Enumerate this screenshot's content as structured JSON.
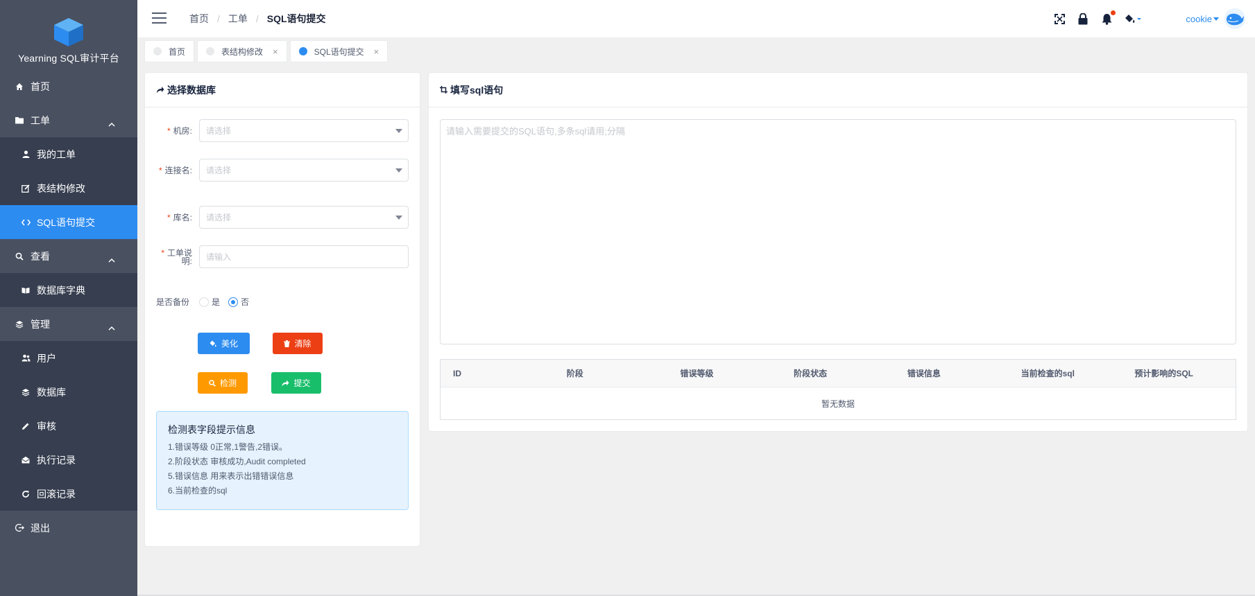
{
  "app": {
    "title": "Yearning SQL审计平台"
  },
  "sidebar": {
    "items": [
      {
        "label": "首页"
      },
      {
        "label": "工单"
      },
      {
        "label": "我的工单"
      },
      {
        "label": "表结构修改"
      },
      {
        "label": "SQL语句提交"
      },
      {
        "label": "查看"
      },
      {
        "label": "数据库字典"
      },
      {
        "label": "管理"
      },
      {
        "label": "用户"
      },
      {
        "label": "数据库"
      },
      {
        "label": "审核"
      },
      {
        "label": "执行记录"
      },
      {
        "label": "回滚记录"
      },
      {
        "label": "退出"
      }
    ]
  },
  "header": {
    "breadcrumb": [
      "首页",
      "工单",
      "SQL语句提交"
    ],
    "separator": "/",
    "user": "cookie"
  },
  "tags": [
    {
      "label": "首页"
    },
    {
      "label": "表结构修改"
    },
    {
      "label": "SQL语句提交"
    }
  ],
  "left_card": {
    "title": "选择数据库",
    "fields": {
      "room": {
        "label": "机房:",
        "placeholder": "请选择"
      },
      "conn": {
        "label": "连接名:",
        "placeholder": "请选择"
      },
      "db": {
        "label": "库名:",
        "placeholder": "请选择"
      },
      "desc": {
        "label": "工单说明:",
        "placeholder": "请输入"
      }
    },
    "backup": {
      "label": "是否备份",
      "yes": "是",
      "no": "否",
      "selected": "否"
    },
    "buttons": {
      "beautify": "美化",
      "clear": "清除",
      "check": "检测",
      "submit": "提交"
    },
    "tips": {
      "title": "检测表字段提示信息",
      "lines": [
        "1.错误等级 0正常,1警告,2错误。",
        "2.阶段状态 审核成功,Audit completed",
        "5.错误信息 用来表示出错错误信息",
        "6.当前检查的sql"
      ]
    }
  },
  "right_card": {
    "title": "填写sql语句",
    "sql_placeholder": "请输入需要提交的SQL语句,多条sql请用;分隔",
    "table": {
      "columns": [
        "ID",
        "阶段",
        "错误等级",
        "阶段状态",
        "错误信息",
        "当前检查的sql",
        "预计影响的SQL"
      ],
      "empty_text": "暂无数据"
    }
  },
  "colors": {
    "sidebar": "#495060",
    "submenu": "#363e4f",
    "active": "#2d8cf0",
    "beautify": "#2d8cf0",
    "clear": "#ed3f14",
    "check": "#ff9900",
    "submit": "#19be6b"
  }
}
